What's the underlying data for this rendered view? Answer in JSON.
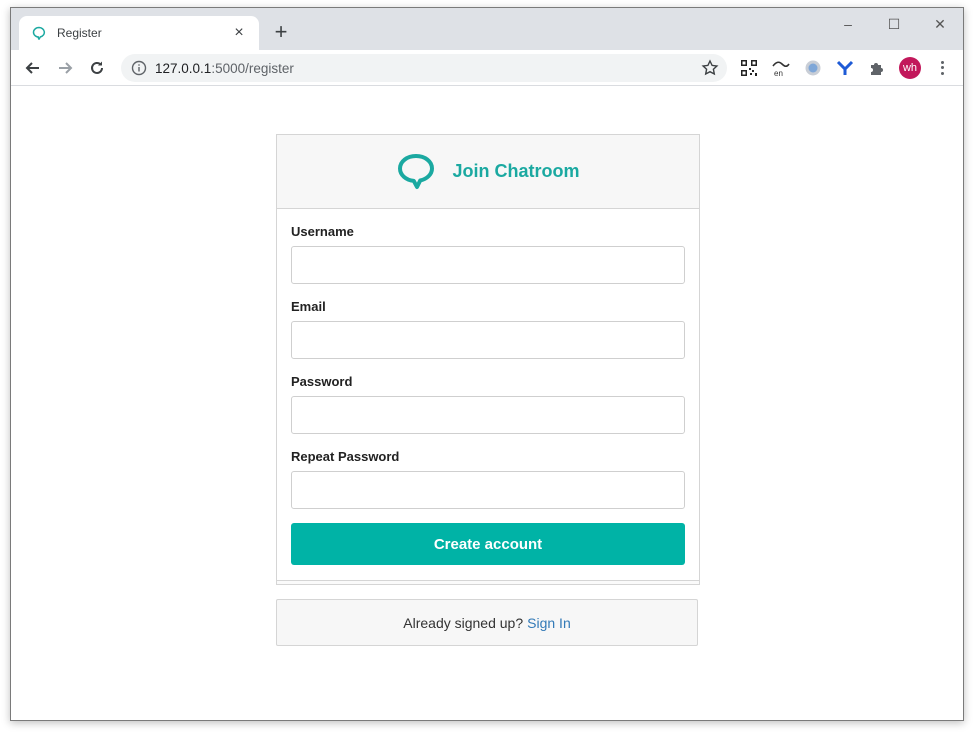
{
  "browser": {
    "tab_title": "Register",
    "url_host": "127.0.0.1",
    "url_path": ":5000/register",
    "avatar_initials": "wh",
    "ext_label": "en"
  },
  "card": {
    "title": "Join Chatroom",
    "fields": [
      {
        "label": "Username",
        "value": "",
        "placeholder": ""
      },
      {
        "label": "Email",
        "value": "",
        "placeholder": ""
      },
      {
        "label": "Password",
        "value": "",
        "placeholder": ""
      },
      {
        "label": "Repeat Password",
        "value": "",
        "placeholder": ""
      }
    ],
    "submit_label": "Create account"
  },
  "footer": {
    "prompt": "Already signed up?",
    "link": "Sign In"
  },
  "colors": {
    "accent": "#00b3a6",
    "title": "#1ba9a1",
    "link": "#337ab7",
    "avatar": "#c2185b"
  }
}
